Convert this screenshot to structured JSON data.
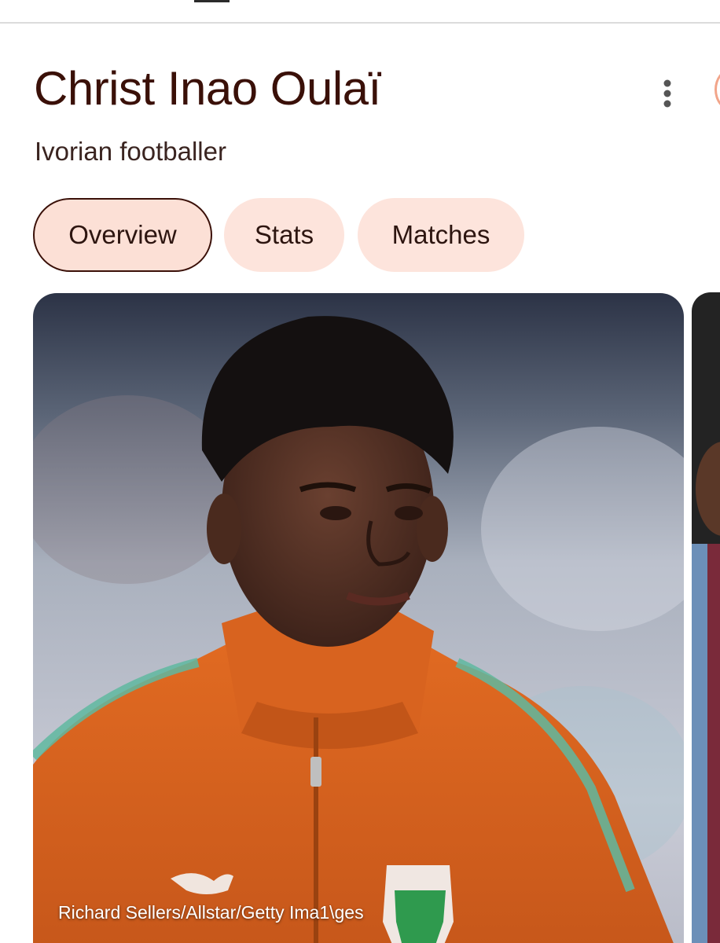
{
  "header": {
    "title": "Christ Inao Oulaï",
    "subtitle": "Ivorian footballer"
  },
  "tabs": [
    {
      "label": "Overview",
      "active": true
    },
    {
      "label": "Stats",
      "active": false
    },
    {
      "label": "Matches",
      "active": false
    }
  ],
  "image": {
    "credit": "Richard Sellers/Allstar/Getty Ima1\\ges"
  },
  "colors": {
    "title": "#3a1008",
    "chip_bg": "#fde4dc",
    "chip_active_border": "#3a1008",
    "jersey": "#d9621c"
  },
  "icons": {
    "more": "more-vert-icon"
  }
}
